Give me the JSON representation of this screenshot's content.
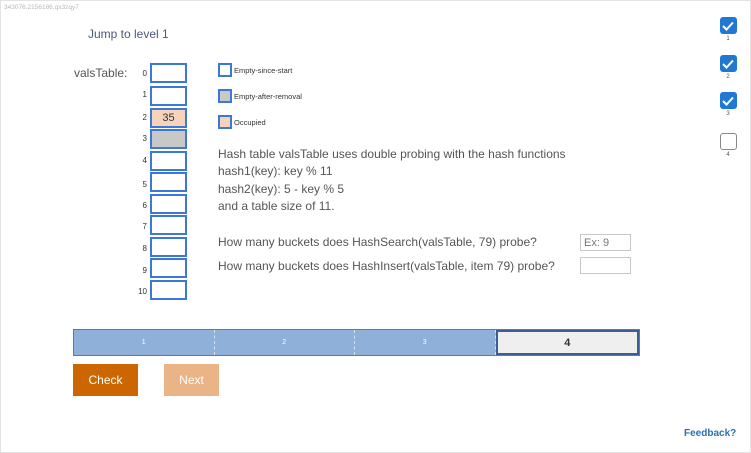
{
  "session_id": "343076.2156186.qx3zqy7",
  "jump_link": "Jump to level 1",
  "table": {
    "label": "valsTable:",
    "buckets": [
      {
        "index": "0",
        "value": "",
        "state": "empty"
      },
      {
        "index": "1",
        "value": "",
        "state": "empty"
      },
      {
        "index": "2",
        "value": "35",
        "state": "occupied"
      },
      {
        "index": "3",
        "value": "",
        "state": "removed"
      },
      {
        "index": "4",
        "value": "",
        "state": "empty"
      },
      {
        "index": "5",
        "value": "",
        "state": "empty"
      },
      {
        "index": "6",
        "value": "",
        "state": "empty"
      },
      {
        "index": "7",
        "value": "",
        "state": "empty"
      },
      {
        "index": "8",
        "value": "",
        "state": "empty"
      },
      {
        "index": "9",
        "value": "",
        "state": "empty"
      },
      {
        "index": "10",
        "value": "",
        "state": "empty"
      }
    ]
  },
  "legend": {
    "empty_since_start": "Empty-since-start",
    "empty_after_removal": "Empty-after-removal",
    "occupied": "Occupied"
  },
  "description": {
    "line1": "Hash table valsTable uses double probing with the hash functions",
    "line2": "hash1(key): key % 11",
    "line3": "hash2(key): 5 - key % 5",
    "line4": "and a table size of 11."
  },
  "questions": {
    "q1": "How many buckets does HashSearch(valsTable, 79) probe?",
    "q1_placeholder": "Ex: 9",
    "q2": "How many buckets does HashInsert(valsTable, item 79) probe?",
    "q2_placeholder": ""
  },
  "progress": {
    "segments": [
      "1",
      "2",
      "3",
      "4"
    ],
    "current": 4
  },
  "buttons": {
    "check": "Check",
    "next": "Next"
  },
  "feedback": "Feedback?",
  "side_steps": [
    {
      "num": "1",
      "done": true
    },
    {
      "num": "2",
      "done": true
    },
    {
      "num": "3",
      "done": true
    },
    {
      "num": "4",
      "done": false
    }
  ],
  "colors": {
    "bucket_border": "#3c78d8",
    "occupied": "#f8d3bb",
    "removed": "#c8c8c8",
    "check_button": "#cc6600",
    "next_button": "#eab487",
    "progress_fill": "#8fb0d8",
    "step_done": "#1f78d1"
  }
}
